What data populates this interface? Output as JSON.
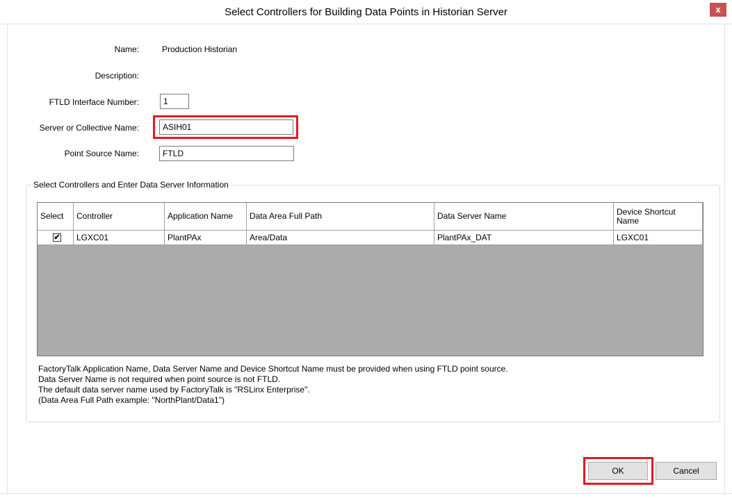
{
  "window": {
    "title": "Select Controllers for Building Data Points in Historian Server",
    "close_label": "x"
  },
  "form": {
    "name_label": "Name:",
    "name_value": "Production Historian",
    "description_label": "Description:",
    "ftld_label": "FTLD Interface Number:",
    "ftld_value": "1",
    "server_label": "Server or Collective Name:",
    "server_value": "ASIH01",
    "point_source_label": "Point Source Name:",
    "point_source_value": "FTLD"
  },
  "group": {
    "title": "Select Controllers and Enter Data Server Information"
  },
  "grid": {
    "headers": [
      "Select",
      "Controller",
      "Application Name",
      "Data Area Full Path",
      "Data Server Name",
      "Device Shortcut Name"
    ],
    "row": {
      "checked": "✔",
      "controller": "LGXC01",
      "application": "PlantPAx",
      "path": "Area/Data",
      "server": "PlantPAx_DAT",
      "shortcut": "LGXC01"
    }
  },
  "notes": [
    "FactoryTalk Application Name, Data Server Name and Device Shortcut Name must be provided when using FTLD point source.",
    "Data Server Name is not required when point source is not FTLD.",
    "The default data server name used by FactoryTalk is \"RSLinx Enterprise\".",
    "(Data Area Full Path example:  \"NorthPlant/Data1\")"
  ],
  "buttons": {
    "ok": "OK",
    "cancel": "Cancel"
  },
  "colors": {
    "highlight": "#e3191e",
    "grid_empty": "#ababab"
  }
}
